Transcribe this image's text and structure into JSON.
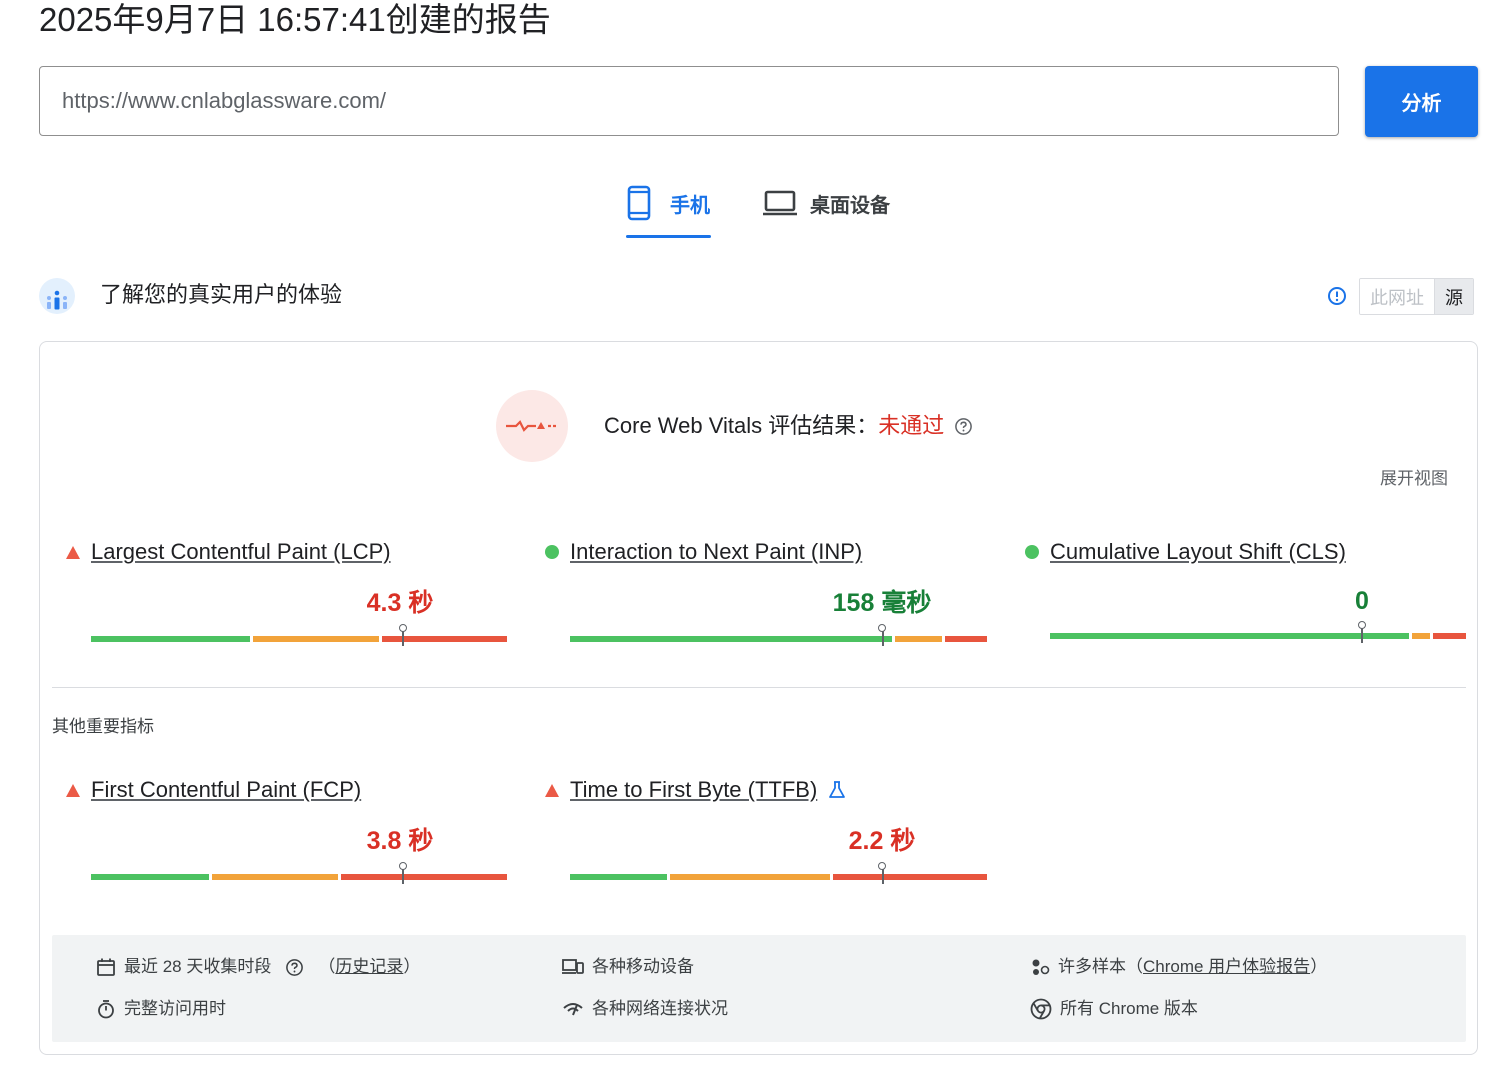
{
  "page_title": "2025年9月7日 16:57:41创建的报告",
  "url_input": {
    "value": "https://www.cnlabglassware.com/"
  },
  "analyze_button": "分析",
  "tabs": [
    {
      "label": "手机",
      "icon": "smartphone-icon",
      "active": true
    },
    {
      "label": "桌面设备",
      "icon": "laptop-icon",
      "active": false
    }
  ],
  "section": {
    "title": "了解您的真实用户的体验",
    "icon": "crux-users-icon",
    "toggle": {
      "url_label": "此网址",
      "origin_label": "源"
    }
  },
  "cwv": {
    "label": "Core Web Vitals 评估结果：",
    "status": "未通过",
    "status_color": "#d93025",
    "expand_link": "展开视图"
  },
  "metrics": [
    {
      "name": "Largest Contentful Paint (LCP)",
      "value": "4.3 秒",
      "status": "fail",
      "distribution": {
        "good": 0.39,
        "needs_improvement": 0.31,
        "poor": 0.3
      },
      "marker": 0.75
    },
    {
      "name": "Interaction to Next Paint (INP)",
      "value": "158 毫秒",
      "status": "pass",
      "distribution": {
        "good": 0.78,
        "needs_improvement": 0.12,
        "poor": 0.1
      },
      "marker": 0.75
    },
    {
      "name": "Cumulative Layout Shift (CLS)",
      "value": "0",
      "status": "pass",
      "distribution": {
        "good": 0.87,
        "needs_improvement": 0.05,
        "poor": 0.08
      },
      "marker": 0.75
    }
  ],
  "other_metrics_label": "其他重要指标",
  "other_metrics": [
    {
      "name": "First Contentful Paint (FCP)",
      "value": "3.8 秒",
      "status": "fail",
      "distribution": {
        "good": 0.29,
        "needs_improvement": 0.31,
        "poor": 0.4
      },
      "marker": 0.75
    },
    {
      "name": "Time to First Byte (TTFB)",
      "value": "2.2 秒",
      "status": "fail",
      "distribution": {
        "good": 0.24,
        "needs_improvement": 0.39,
        "poor": 0.37
      },
      "marker": 0.75,
      "experimental_icon": "flask-icon"
    }
  ],
  "info": {
    "period_prefix": "最近 28 天收集时段",
    "history_open": "（",
    "history_link": "历史记录",
    "history_close": "）",
    "duration": "完整访问用时",
    "devices": "各种移动设备",
    "network": "各种网络连接状况",
    "samples_prefix": "许多样本（",
    "samples_link": "Chrome 用户体验报告",
    "samples_close": "）",
    "chrome_versions": "所有 Chrome 版本"
  },
  "colors": {
    "good": "#4cc261",
    "needs_improvement": "#f2a33a",
    "poor": "#e8553e",
    "accent": "#1a73e8"
  }
}
